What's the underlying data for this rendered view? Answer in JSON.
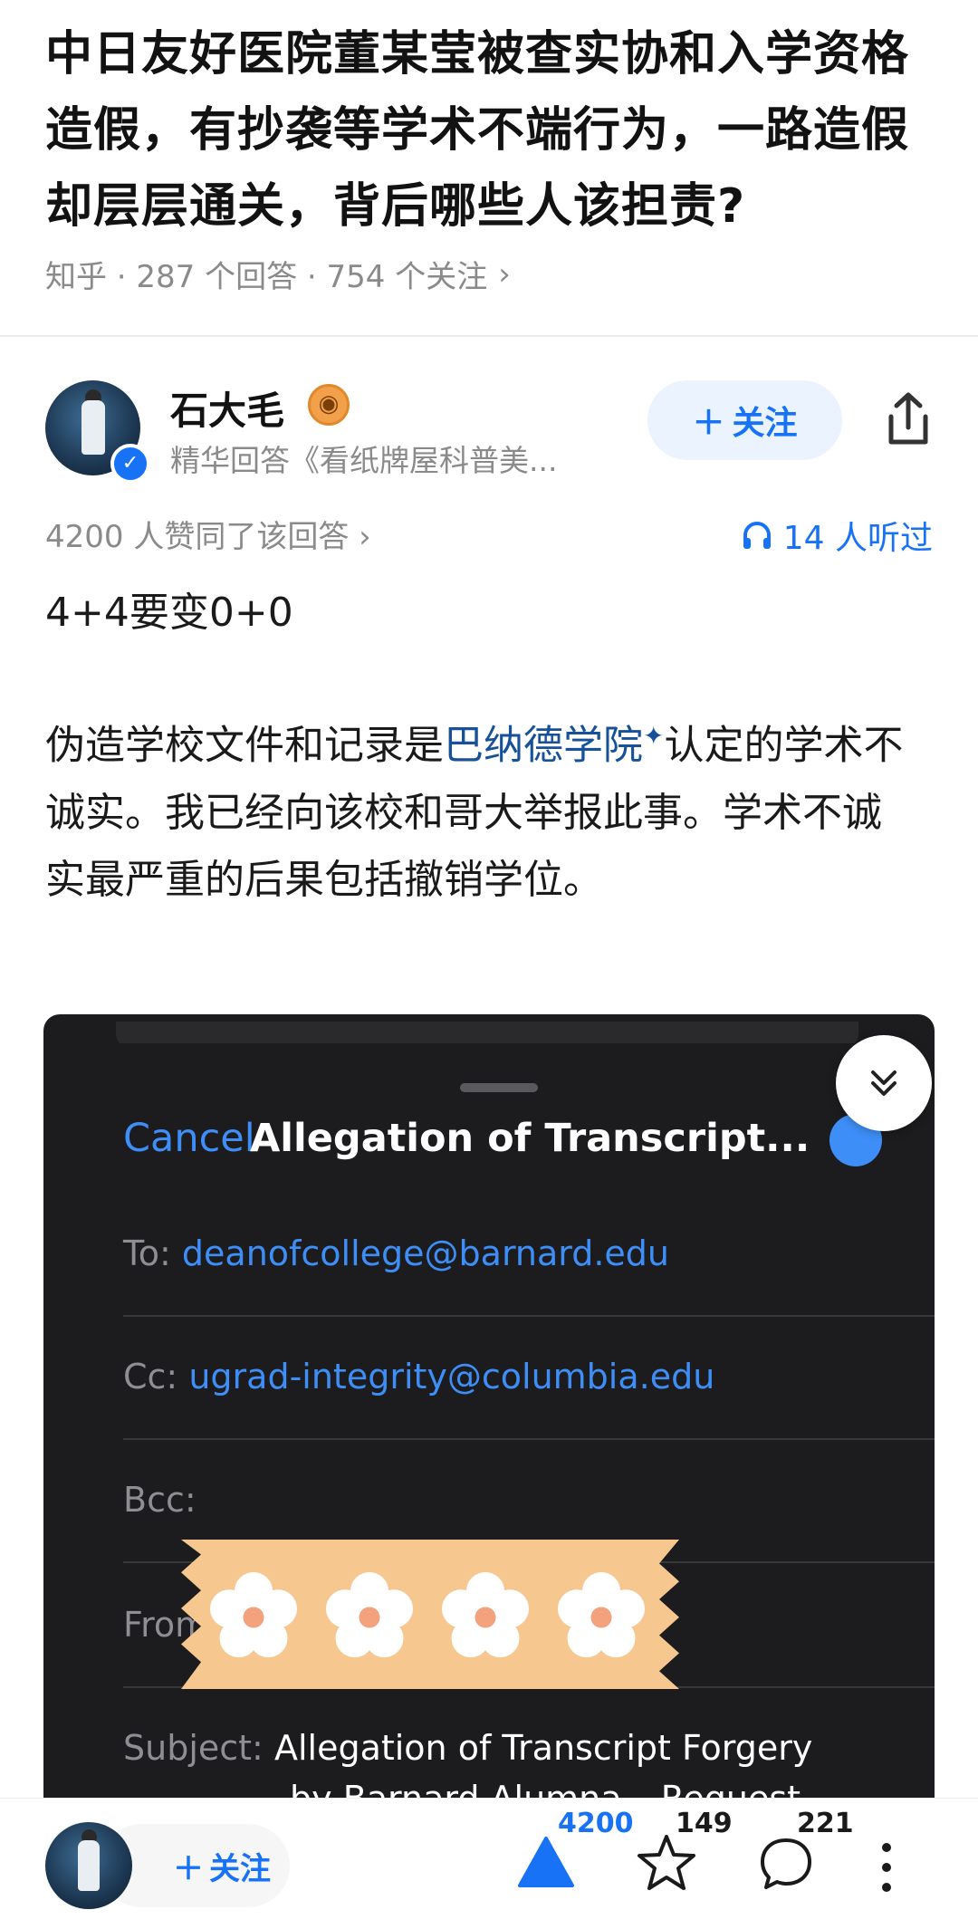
{
  "question": {
    "title": "中日友好医院董某莹被查实协和入学资格造假，有抄袭等学术不端行为，一路造假却层层通关，背后哪些人该担责?",
    "meta": "知乎 · 287 个回答 · 754 个关注"
  },
  "author": {
    "name": "石大毛",
    "tag": "精华回答《看纸牌屋科普美...",
    "follow_label": "关注"
  },
  "stats": {
    "likes_text": "4200 人赞同了该回答",
    "listen_text": "14 人听过"
  },
  "answer": {
    "line1": "4+4要变0+0",
    "p2_before": "伪造学校文件和记录是",
    "p2_link": "巴纳德学院",
    "p2_after": "认定的学术不诚实。我已经向该校和哥大举报此事。学术不诚实最严重的后果包括撤销学位。"
  },
  "email": {
    "cancel": "Cancel",
    "title": "Allegation of Transcript...",
    "to_label": "To:",
    "to_value": "deanofcollege@barnard.edu",
    "cc_label": "Cc:",
    "cc_value": "ugrad-integrity@columbia.edu",
    "bcc_label": "Bcc:",
    "from_label": "From:",
    "subject_label": "Subject:",
    "subject_line1": "Allegation of Transcript Forgery",
    "subject_line2": "by Barnard Alumna – Request"
  },
  "bottom_bar": {
    "follow_label": "关注",
    "upvote_count": "4200",
    "favorite_count": "149",
    "comment_count": "221"
  },
  "colors": {
    "accent": "#1772f6",
    "ios_blue": "#3e8ef7",
    "dark_bg": "#1c1c1e"
  }
}
